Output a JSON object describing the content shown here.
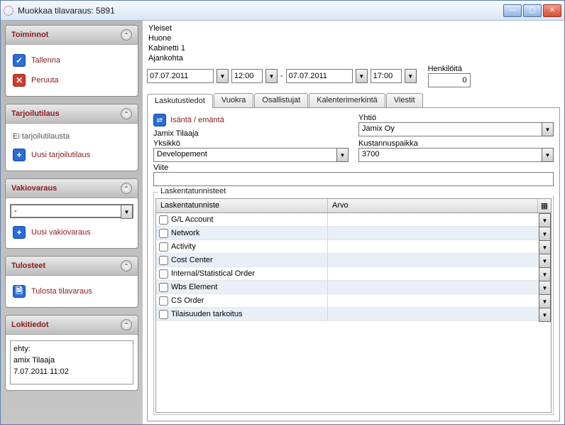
{
  "window": {
    "title": "Muokkaa tilavaraus: 5891"
  },
  "sidebar": {
    "toiminnot": {
      "title": "Toiminnot",
      "save": "Tallenna",
      "cancel": "Peruuta"
    },
    "tarjoilu": {
      "title": "Tarjoilutilaus",
      "status": "Ei tarjoilutilausta",
      "new": "Uusi tarjoilutilaus"
    },
    "vakio": {
      "title": "Vakiovaraus",
      "selected": "-",
      "new": "Uusi vakiovaraus"
    },
    "tulosteet": {
      "title": "Tulosteet",
      "print": "Tulosta tilavaraus"
    },
    "loki": {
      "title": "Lokitiedot",
      "lines": [
        "ehty:",
        "amix Tilaaja",
        "7.07.2011 11:02"
      ]
    }
  },
  "main": {
    "h1": "Yleiset",
    "h2": "Huone",
    "h3": "Kabinetti 1",
    "dt_label": "Ajankohta",
    "date1": "07.07.2011",
    "time1": "12:00",
    "sep": "-",
    "date2": "07.07.2011",
    "time2": "17:00",
    "persons_label": "Henkilöitä",
    "persons": "0"
  },
  "tabs": {
    "items": [
      "Laskutustiedot",
      "Vuokra",
      "Osallistujat",
      "Kalenterimerkintä",
      "Viestit"
    ]
  },
  "billing": {
    "host_link": "Isäntä / emäntä",
    "host_value": "Jamix Tilaaja",
    "company_label": "Yhtiö",
    "company_value": "Jamix Oy",
    "unit_label": "Yksikkö",
    "unit_value": "Developement",
    "cc_label": "Kustannuspaikka",
    "cc_value": "3700",
    "ref_label": "Viite",
    "ref_value": "",
    "group_label": "Laskentatunnisteet",
    "col1": "Laskentatunniste",
    "col2": "Arvo",
    "rows": [
      {
        "name": "G/L Account"
      },
      {
        "name": "Network"
      },
      {
        "name": "Activity"
      },
      {
        "name": "Cost Center"
      },
      {
        "name": "Internal/Statistical Order"
      },
      {
        "name": "Wbs Element"
      },
      {
        "name": "CS Order"
      },
      {
        "name": "Tilaisuuden tarkoitus"
      }
    ]
  }
}
